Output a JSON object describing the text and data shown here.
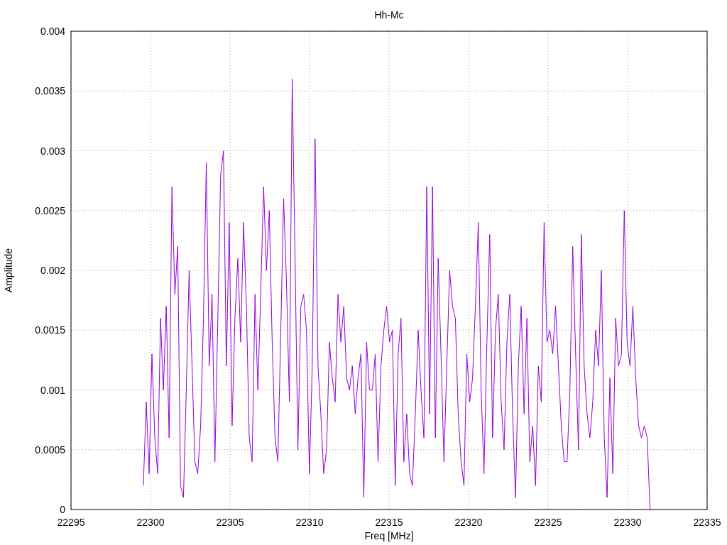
{
  "chart_data": {
    "type": "line",
    "grid": true,
    "title": "Hh-Mc",
    "xlabel": "Freq [MHz]",
    "ylabel": "Amplitude",
    "xlim": [
      22295,
      22335
    ],
    "ylim": [
      0,
      0.004
    ],
    "xticks": [
      22295,
      22300,
      22305,
      22310,
      22315,
      22320,
      22325,
      22330,
      22335
    ],
    "yticks": [
      0,
      0.0005,
      0.001,
      0.0015,
      0.002,
      0.0025,
      0.003,
      0.0035,
      0.004
    ],
    "x": [
      22299.55,
      22299.73,
      22299.91,
      22300.09,
      22300.27,
      22300.45,
      22300.63,
      22300.81,
      22300.99,
      22301.17,
      22301.35,
      22301.53,
      22301.71,
      22301.89,
      22302.07,
      22302.25,
      22302.43,
      22302.61,
      22302.79,
      22302.97,
      22303.15,
      22303.33,
      22303.51,
      22303.69,
      22303.87,
      22304.05,
      22304.23,
      22304.41,
      22304.59,
      22304.77,
      22304.95,
      22305.13,
      22305.31,
      22305.49,
      22305.67,
      22305.85,
      22306.03,
      22306.21,
      22306.39,
      22306.57,
      22306.75,
      22306.93,
      22307.11,
      22307.29,
      22307.47,
      22307.65,
      22307.83,
      22308.01,
      22308.19,
      22308.37,
      22308.55,
      22308.73,
      22308.91,
      22309.09,
      22309.27,
      22309.45,
      22309.63,
      22309.81,
      22309.99,
      22310.17,
      22310.35,
      22310.53,
      22310.71,
      22310.89,
      22311.07,
      22311.25,
      22311.43,
      22311.61,
      22311.79,
      22311.97,
      22312.15,
      22312.33,
      22312.51,
      22312.69,
      22312.87,
      22313.05,
      22313.23,
      22313.41,
      22313.59,
      22313.77,
      22313.95,
      22314.13,
      22314.31,
      22314.49,
      22314.67,
      22314.85,
      22315.03,
      22315.21,
      22315.39,
      22315.57,
      22315.75,
      22315.93,
      22316.11,
      22316.29,
      22316.47,
      22316.65,
      22316.83,
      22317.01,
      22317.19,
      22317.37,
      22317.55,
      22317.73,
      22317.91,
      22318.09,
      22318.27,
      22318.45,
      22318.63,
      22318.81,
      22318.99,
      22319.17,
      22319.35,
      22319.53,
      22319.71,
      22319.89,
      22320.07,
      22320.25,
      22320.43,
      22320.61,
      22320.79,
      22320.97,
      22321.15,
      22321.33,
      22321.51,
      22321.69,
      22321.87,
      22322.05,
      22322.23,
      22322.41,
      22322.59,
      22322.77,
      22322.95,
      22323.13,
      22323.31,
      22323.49,
      22323.67,
      22323.85,
      22324.03,
      22324.21,
      22324.39,
      22324.57,
      22324.75,
      22324.93,
      22325.11,
      22325.29,
      22325.47,
      22325.65,
      22325.83,
      22326.01,
      22326.19,
      22326.37,
      22326.55,
      22326.73,
      22326.91,
      22327.09,
      22327.27,
      22327.45,
      22327.63,
      22327.81,
      22327.99,
      22328.17,
      22328.35,
      22328.53,
      22328.71,
      22328.89,
      22329.07,
      22329.25,
      22329.43,
      22329.61,
      22329.79,
      22329.97,
      22330.15,
      22330.33,
      22330.51,
      22330.69,
      22330.87,
      22331.05,
      22331.23,
      22331.41
    ],
    "series": [
      {
        "color": "#9400d3",
        "values": [
          0.0002,
          0.0009,
          0.0003,
          0.0013,
          0.0006,
          0.0003,
          0.0016,
          0.001,
          0.0017,
          0.0006,
          0.0027,
          0.0018,
          0.0022,
          0.0002,
          0.0001,
          0.001,
          0.002,
          0.0012,
          0.0004,
          0.0003,
          0.0007,
          0.0016,
          0.0029,
          0.0012,
          0.0018,
          0.0004,
          0.0016,
          0.0028,
          0.003,
          0.0012,
          0.0024,
          0.0007,
          0.0016,
          0.0021,
          0.0014,
          0.0024,
          0.0017,
          0.0006,
          0.0004,
          0.0018,
          0.001,
          0.0018,
          0.0027,
          0.002,
          0.0025,
          0.0014,
          0.0006,
          0.0004,
          0.0015,
          0.0026,
          0.0019,
          0.0009,
          0.0036,
          0.0021,
          0.0005,
          0.0017,
          0.0018,
          0.0015,
          0.0003,
          0.0012,
          0.0031,
          0.0012,
          0.0008,
          0.0003,
          0.0005,
          0.0014,
          0.0011,
          0.0009,
          0.0018,
          0.0014,
          0.0017,
          0.0011,
          0.001,
          0.0012,
          0.0008,
          0.0011,
          0.0013,
          0.0001,
          0.0014,
          0.001,
          0.001,
          0.0013,
          0.0004,
          0.0012,
          0.0015,
          0.0017,
          0.0014,
          0.0015,
          0.0002,
          0.0013,
          0.0016,
          0.0004,
          0.0008,
          0.0003,
          0.0002,
          0.0008,
          0.0015,
          0.001,
          0.0006,
          0.0027,
          0.0008,
          0.0027,
          0.0006,
          0.0021,
          0.0013,
          0.0004,
          0.0012,
          0.002,
          0.0017,
          0.0016,
          0.0008,
          0.0004,
          0.0002,
          0.0013,
          0.0009,
          0.0011,
          0.0017,
          0.0024,
          0.001,
          0.0003,
          0.0014,
          0.0023,
          0.0006,
          0.0015,
          0.0018,
          0.0009,
          0.0005,
          0.0014,
          0.0018,
          0.0008,
          0.0001,
          0.0012,
          0.0017,
          0.0008,
          0.0016,
          0.0004,
          0.0007,
          0.0002,
          0.0012,
          0.0009,
          0.0024,
          0.0014,
          0.0015,
          0.0013,
          0.0017,
          0.0012,
          0.0007,
          0.0004,
          0.0004,
          0.001,
          0.0022,
          0.0013,
          0.0005,
          0.0023,
          0.0012,
          0.0008,
          0.0006,
          0.0009,
          0.0015,
          0.0012,
          0.002,
          0.0006,
          0.0001,
          0.0011,
          0.0003,
          0.0016,
          0.0012,
          0.0013,
          0.0025,
          0.0014,
          0.0012,
          0.0017,
          0.0011,
          0.0007,
          0.0006,
          0.0007,
          0.0006,
          0
        ]
      }
    ]
  }
}
